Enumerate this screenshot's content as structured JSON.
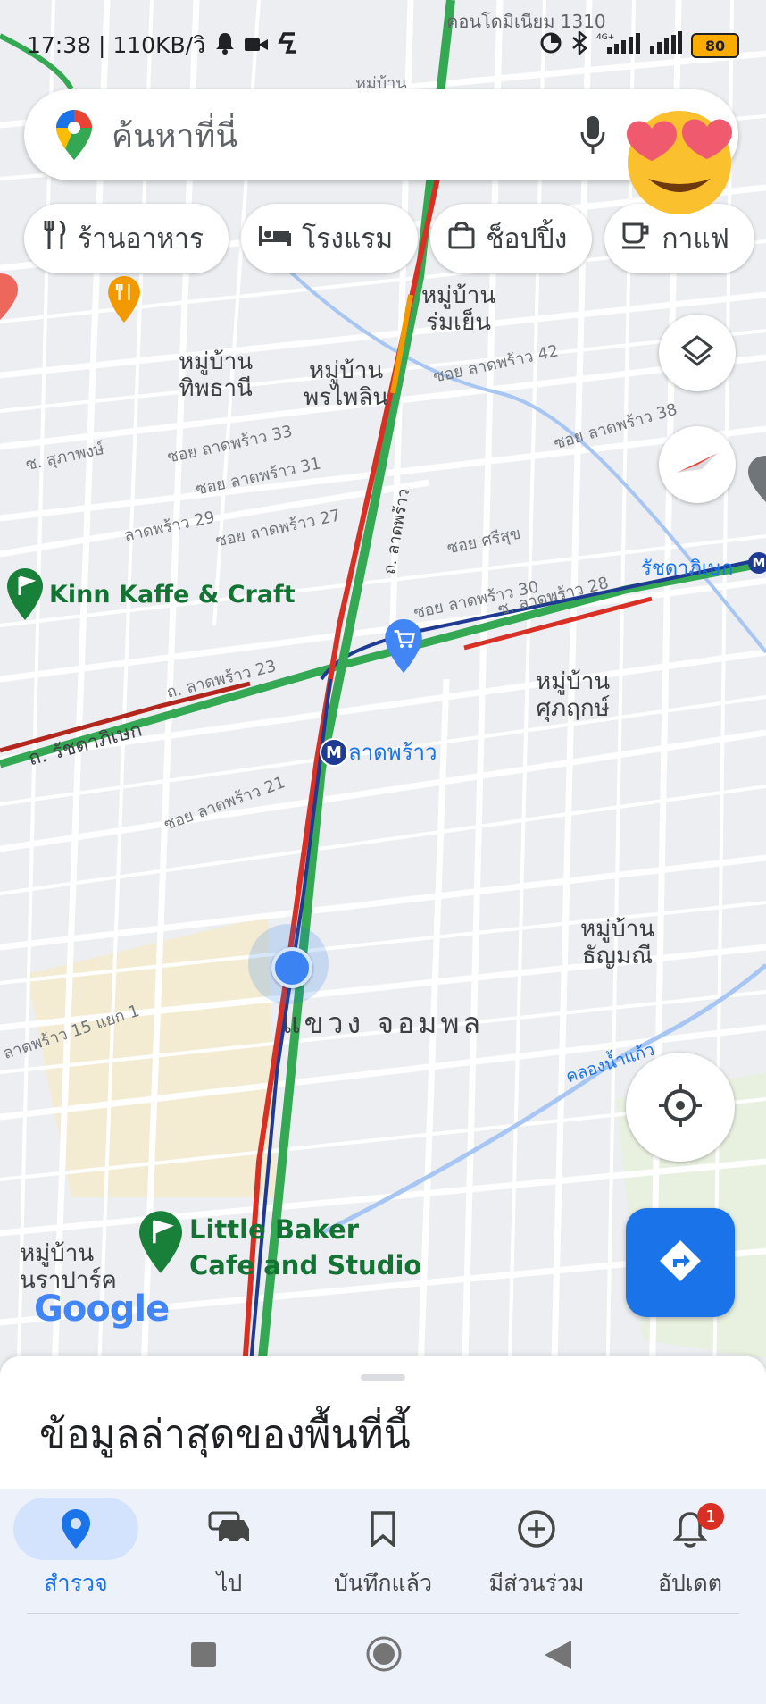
{
  "status_bar": {
    "time_speed": "17:38 | 110KB/วิ",
    "battery": "80"
  },
  "search": {
    "placeholder": "ค้นหาที่นี่"
  },
  "chips": [
    {
      "label": "ร้านอาหาร",
      "icon": "restaurant-icon"
    },
    {
      "label": "โรงแรม",
      "icon": "hotel-icon"
    },
    {
      "label": "ช็อปปิ้ง",
      "icon": "shopping-bag-icon"
    },
    {
      "label": "กาแฟ",
      "icon": "coffee-icon"
    }
  ],
  "map": {
    "labels": {
      "condo": "คอนโดมิเนียม 1310",
      "village_top": "หมู่บ้าน",
      "village_romyen": "หมู่บ้าน\nร่มเย็น",
      "village_thipthani": "หมู่บ้าน\nทิพธานี",
      "village_phraphailin": "หมู่บ้าน\nพรไพลิน",
      "village_suphaluek": "หมู่บ้าน\nศุภฤกษ์",
      "village_thanyamanee": "หมู่บ้าน\nธัญมณี",
      "village_nararpark": "หมู่บ้าน\nนราปาร์ค",
      "district": "แขวง จอมพล",
      "canal": "คลองน้ำแก้ว",
      "station": "ลาดพร้าว",
      "ratchada": "รัชดาภิเษก",
      "road_ratchada": "ถ. รัชดาภิเษก",
      "road_ladprao": "ถ. ลาดพร้าว",
      "road_ladprao23": "ถ. ลาดพร้าว 23",
      "soi42": "ซอย ลาดพร้าว 42",
      "soi38": "ซอย ลาดพร้าว 38",
      "soi33": "ซอย ลาดพร้าว 33",
      "soi31": "ซอย ลาดพร้าว 31",
      "soi29": "ลาดพร้าว 29",
      "soi27": "ซอย ลาดพร้าว 27",
      "soi30": "ซอย ลาดพร้าว 30",
      "soi28": "ซ. ลาดพร้าว 28",
      "soi21": "ซอย ลาดพร้าว 21",
      "soi15": "ลาดพร้าว 15 แยก 1",
      "srisuk": "ซอย ศรีสุข",
      "suphaphong": "ซ. สุภาพงษ์"
    },
    "places": {
      "kinn": "Kinn Kaffe & Craft",
      "little_baker": "Little Baker\nCafe and Studio"
    },
    "google_logo": "Google"
  },
  "sheet": {
    "title": "ข้อมูลล่าสุดของพื้นที่นี้"
  },
  "bottom_nav": [
    {
      "label": "สำรวจ",
      "icon": "explore-pin-icon",
      "active": true
    },
    {
      "label": "ไป",
      "icon": "car-icon",
      "active": false
    },
    {
      "label": "บันทึกแล้ว",
      "icon": "bookmark-icon",
      "active": false
    },
    {
      "label": "มีส่วนร่วม",
      "icon": "add-circle-icon",
      "active": false
    },
    {
      "label": "อัปเดต",
      "icon": "bell-icon",
      "active": false,
      "badge": "1"
    }
  ],
  "colors": {
    "accent": "#1a73e8",
    "traffic_green": "#34a853",
    "traffic_red": "#d93025",
    "traffic_orange": "#f29900",
    "metro_navy": "#1f3a93"
  }
}
